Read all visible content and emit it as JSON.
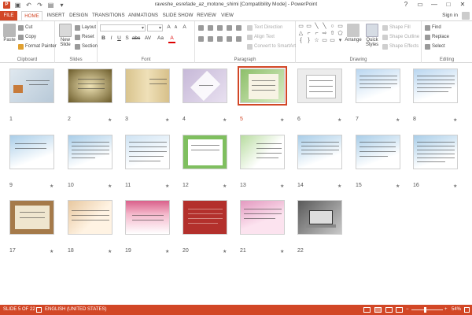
{
  "window": {
    "title": "raveshe_esrefade_az_motone_shimi [Compatibility Mode] - PowerPoint",
    "signin": "Sign in"
  },
  "qat": {
    "app_icon": "P",
    "save": "▣",
    "undo": "↶",
    "redo": "↷",
    "start": "▤",
    "customize": "▾"
  },
  "window_buttons": {
    "help": "?",
    "restore": "▭",
    "minimize": "—",
    "maximize": "□",
    "close": "✕"
  },
  "tabs": [
    "FILE",
    "HOME",
    "INSERT",
    "DESIGN",
    "TRANSITIONS",
    "ANIMATIONS",
    "SLIDE SHOW",
    "REVIEW",
    "VIEW"
  ],
  "active_tab": "HOME",
  "ribbon": {
    "clipboard": {
      "label": "Clipboard",
      "paste": "Paste",
      "cut": "Cut",
      "copy": "Copy",
      "format_painter": "Format Painter"
    },
    "slides": {
      "label": "Slides",
      "new_slide": "New Slide",
      "layout": "Layout",
      "reset": "Reset",
      "section": "Section"
    },
    "font": {
      "label": "Font",
      "bold": "B",
      "italic": "I",
      "underline": "U",
      "shadow": "S",
      "strike": "abc",
      "grow": "A",
      "shrink": "A",
      "clear": "A",
      "spacing": "AV",
      "case": "Aa",
      "color": "A"
    },
    "paragraph": {
      "label": "Paragraph",
      "text_direction": "Text Direction",
      "align_text": "Align Text",
      "smartart": "Convert to SmartArt"
    },
    "drawing": {
      "label": "Drawing",
      "arrange": "Arrange",
      "quick_styles": "Quick Styles",
      "shape_fill": "Shape Fill",
      "shape_outline": "Shape Outline",
      "shape_effects": "Shape Effects",
      "shapes": [
        "▭",
        "▭",
        "╲",
        "╲",
        "○",
        "▭",
        "△",
        "⌐",
        "⌐",
        "⇨",
        "⇧",
        "⬠",
        "{",
        "}",
        "☆",
        "▭",
        "▭",
        "▾"
      ]
    },
    "editing": {
      "label": "Editing",
      "find": "Find",
      "replace": "Replace",
      "select": "Select"
    }
  },
  "slides": [
    {
      "num": "1",
      "star": ""
    },
    {
      "num": "2",
      "star": "★"
    },
    {
      "num": "3",
      "star": "★"
    },
    {
      "num": "4",
      "star": "★"
    },
    {
      "num": "5",
      "star": "★"
    },
    {
      "num": "6",
      "star": "★"
    },
    {
      "num": "7",
      "star": "★"
    },
    {
      "num": "8",
      "star": "★"
    },
    {
      "num": "9",
      "star": "★"
    },
    {
      "num": "10",
      "star": "★"
    },
    {
      "num": "11",
      "star": "★"
    },
    {
      "num": "12",
      "star": "★"
    },
    {
      "num": "13",
      "star": "★"
    },
    {
      "num": "14",
      "star": "★"
    },
    {
      "num": "15",
      "star": "★"
    },
    {
      "num": "16",
      "star": "★"
    },
    {
      "num": "17",
      "star": "★"
    },
    {
      "num": "18",
      "star": "★"
    },
    {
      "num": "19",
      "star": "★"
    },
    {
      "num": "20",
      "star": "★"
    },
    {
      "num": "21",
      "star": "★"
    },
    {
      "num": "22",
      "star": ""
    }
  ],
  "selected_slide": "5",
  "status": {
    "slide_info": "SLIDE 5 OF 22",
    "language": "ENGLISH (UNITED STATES)",
    "zoom": "54%",
    "zoom_minus": "−",
    "zoom_plus": "+"
  },
  "colors": {
    "accent": "#d24726"
  }
}
